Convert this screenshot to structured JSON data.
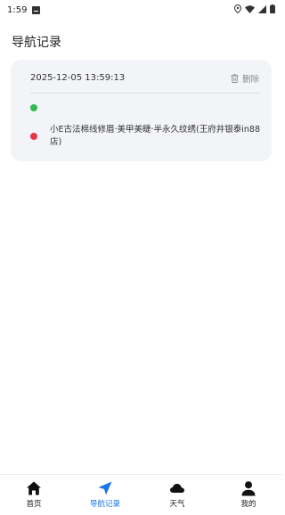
{
  "status_bar": {
    "time": "1:59"
  },
  "page": {
    "title": "导航记录"
  },
  "record": {
    "time": "2025-12-05 13:59:13",
    "delete_label": "删除",
    "start_name": "",
    "end_name": "小E古法棉线修眉·美甲美睫·半永久纹绣(王府井银泰in88店)",
    "start_color": "#2dbb4e",
    "end_color": "#e8334a"
  },
  "nav": {
    "active_color": "#1a73e8",
    "items": [
      {
        "label": "首页",
        "icon": "home-icon"
      },
      {
        "label": "导航记录",
        "icon": "navigation-arrow-icon"
      },
      {
        "label": "天气",
        "icon": "cloud-icon"
      },
      {
        "label": "我的",
        "icon": "person-icon"
      }
    ]
  }
}
